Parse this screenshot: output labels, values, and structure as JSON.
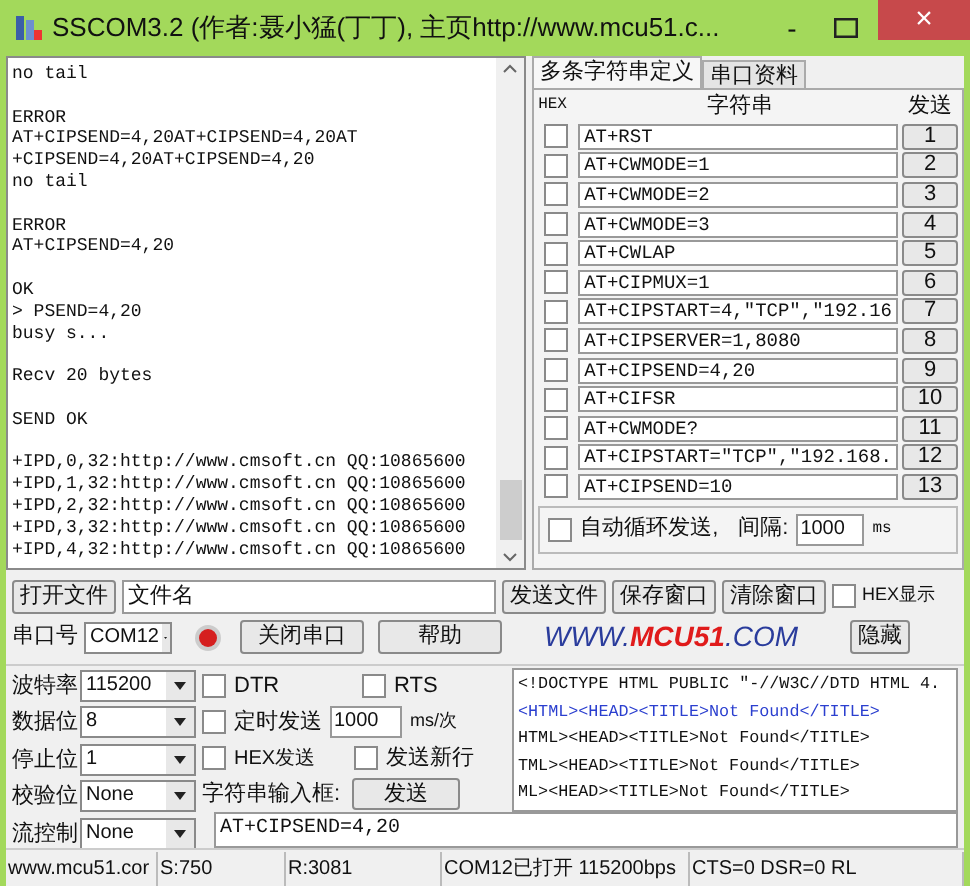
{
  "window": {
    "title": "SSCOM3.2 (作者:聂小猛(丁丁), 主页http://www.mcu51.c...",
    "minimize": "-",
    "close": "×"
  },
  "receive_log": {
    "paragraphs": [
      [
        "no tail"
      ],
      [
        "ERROR",
        "AT+CIPSEND=4,20AT+CIPSEND=4,20AT",
        "+CIPSEND=4,20AT+CIPSEND=4,20",
        "no tail"
      ],
      [
        "ERROR",
        "AT+CIPSEND=4,20"
      ],
      [
        "OK",
        "> PSEND=4,20",
        "busy s..."
      ],
      [
        "Recv 20 bytes"
      ],
      [
        "SEND OK"
      ],
      [
        "+IPD,0,32:http://www.cmsoft.cn QQ:10865600",
        "+IPD,1,32:http://www.cmsoft.cn QQ:10865600",
        "+IPD,2,32:http://www.cmsoft.cn QQ:10865600",
        "+IPD,3,32:http://www.cmsoft.cn QQ:10865600",
        "+IPD,4,32:http://www.cmsoft.cn QQ:10865600"
      ]
    ]
  },
  "string_panel": {
    "tabs": [
      {
        "label": "多条字符串定义",
        "selected": true
      },
      {
        "label": "串口资料",
        "selected": false
      }
    ],
    "header": {
      "hex": "HEX",
      "string": "字符串",
      "send": "发送"
    },
    "rows": [
      {
        "hex": false,
        "text": "AT+RST",
        "button": "1"
      },
      {
        "hex": false,
        "text": "AT+CWMODE=1",
        "button": "2"
      },
      {
        "hex": false,
        "text": "AT+CWMODE=2",
        "button": "3"
      },
      {
        "hex": false,
        "text": "AT+CWMODE=3",
        "button": "4"
      },
      {
        "hex": false,
        "text": "AT+CWLAP",
        "button": "5"
      },
      {
        "hex": false,
        "text": "AT+CIPMUX=1",
        "button": "6"
      },
      {
        "hex": false,
        "text": "AT+CIPSTART=4,\"TCP\",\"192.16",
        "button": "7"
      },
      {
        "hex": false,
        "text": "AT+CIPSERVER=1,8080",
        "button": "8"
      },
      {
        "hex": false,
        "text": "AT+CIPSEND=4,20",
        "button": "9"
      },
      {
        "hex": false,
        "text": "AT+CIFSR",
        "button": "10"
      },
      {
        "hex": false,
        "text": "AT+CWMODE?",
        "button": "11"
      },
      {
        "hex": false,
        "text": "AT+CIPSTART=\"TCP\",\"192.168.",
        "button": "12"
      },
      {
        "hex": false,
        "text": "AT+CIPSEND=10",
        "button": "13"
      }
    ],
    "auto_loop": {
      "label": "自动循环发送,",
      "checked": false,
      "interval_label": "间隔:",
      "interval_value": "1000",
      "unit": "ms"
    }
  },
  "toolbar": {
    "open_file": "打开文件",
    "filename": "文件名",
    "send_file": "发送文件",
    "save_window": "保存窗口",
    "clear_window": "清除窗口",
    "hex_display": {
      "label": "HEX显示",
      "checked": false
    }
  },
  "port_row": {
    "label": "串口号",
    "value": "COM12",
    "port_open": true,
    "close_port": "关闭串口",
    "help": "帮助",
    "logo": [
      "WWW.",
      "MCU51",
      ".COM"
    ],
    "hide": "隐藏"
  },
  "settings": [
    {
      "label": "波特率",
      "value": "115200"
    },
    {
      "label": "数据位",
      "value": "8"
    },
    {
      "label": "停止位",
      "value": "1"
    },
    {
      "label": "校验位",
      "value": "None"
    },
    {
      "label": "流控制",
      "value": "None"
    }
  ],
  "options": {
    "dtr": {
      "label": "DTR",
      "checked": false
    },
    "rts": {
      "label": "RTS",
      "checked": false
    },
    "timed_send": {
      "label": "定时发送",
      "checked": false
    },
    "interval": "1000",
    "interval_unit": "ms/次",
    "hex_send": {
      "label": "HEX发送",
      "checked": false
    },
    "send_newline": {
      "label": "发送新行",
      "checked": false
    },
    "input_label": "字符串输入框:",
    "send": "发送",
    "input_value": "AT+CIPSEND=4,20"
  },
  "preview": [
    {
      "text": "<!DOCTYPE HTML PUBLIC \"-//W3C//DTD HTML 4.",
      "selected": false
    },
    {
      "text": "<HTML><HEAD><TITLE>Not Found</TITLE>",
      "selected": true
    },
    {
      "text": "HTML><HEAD><TITLE>Not Found</TITLE>",
      "selected": false
    },
    {
      "text": "TML><HEAD><TITLE>Not Found</TITLE>",
      "selected": false
    },
    {
      "text": "ML><HEAD><TITLE>Not Found</TITLE>",
      "selected": false
    }
  ],
  "status_bar": [
    "www.mcu51.cor",
    "S:750",
    "R:3081",
    "COM12已打开  115200bps",
    "CTS=0 DSR=0 RL"
  ]
}
